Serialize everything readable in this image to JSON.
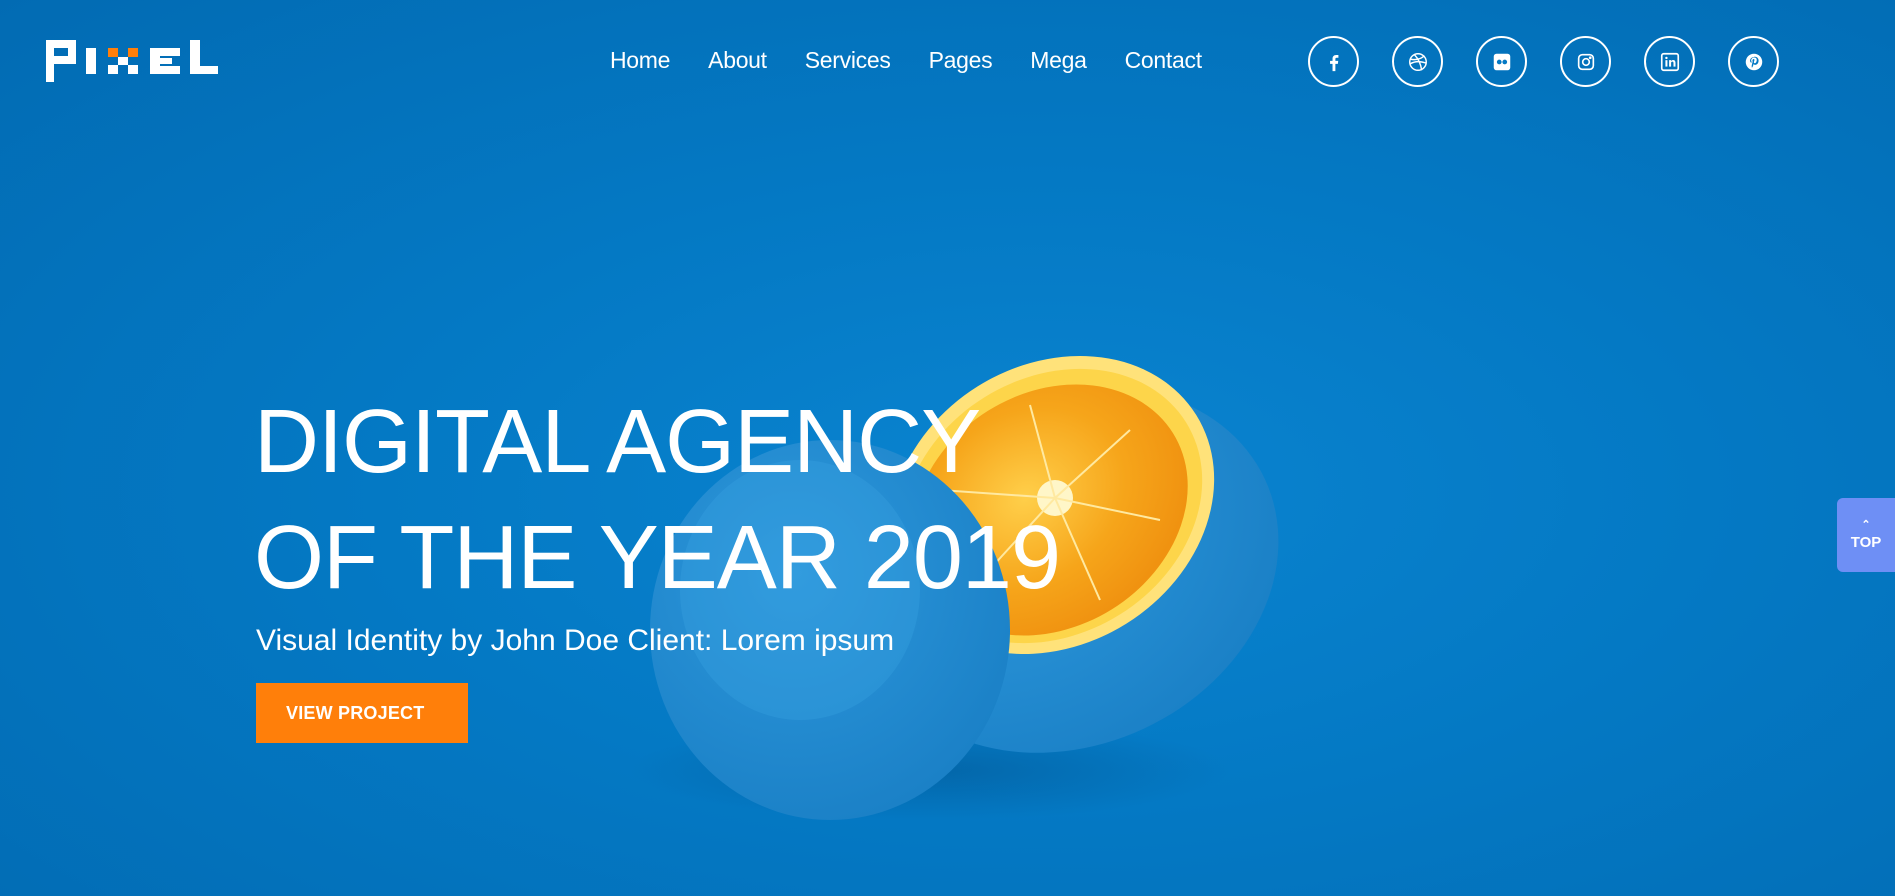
{
  "brand": {
    "logo_text": "PIXEL",
    "accent": "#ff7f0a"
  },
  "nav": {
    "items": [
      "Home",
      "About",
      "Services",
      "Pages",
      "Mega",
      "Contact"
    ]
  },
  "social": [
    "facebook-icon",
    "dribbble-icon",
    "flickr-icon",
    "instagram-icon",
    "linkedin-icon",
    "pinterest-icon"
  ],
  "hero": {
    "headline_line1": "DIGITAL AGENCY",
    "headline_line2": "OF THE YEAR 2019",
    "subtitle": "Visual Identity by John Doe Client: Lorem ipsum",
    "cta_label": "VIEW PROJECT"
  },
  "scroll_top": {
    "label": "TOP"
  },
  "colors": {
    "background": "#0479c4",
    "button": "#ff7f0a",
    "top_button": "#6e8ff5"
  }
}
